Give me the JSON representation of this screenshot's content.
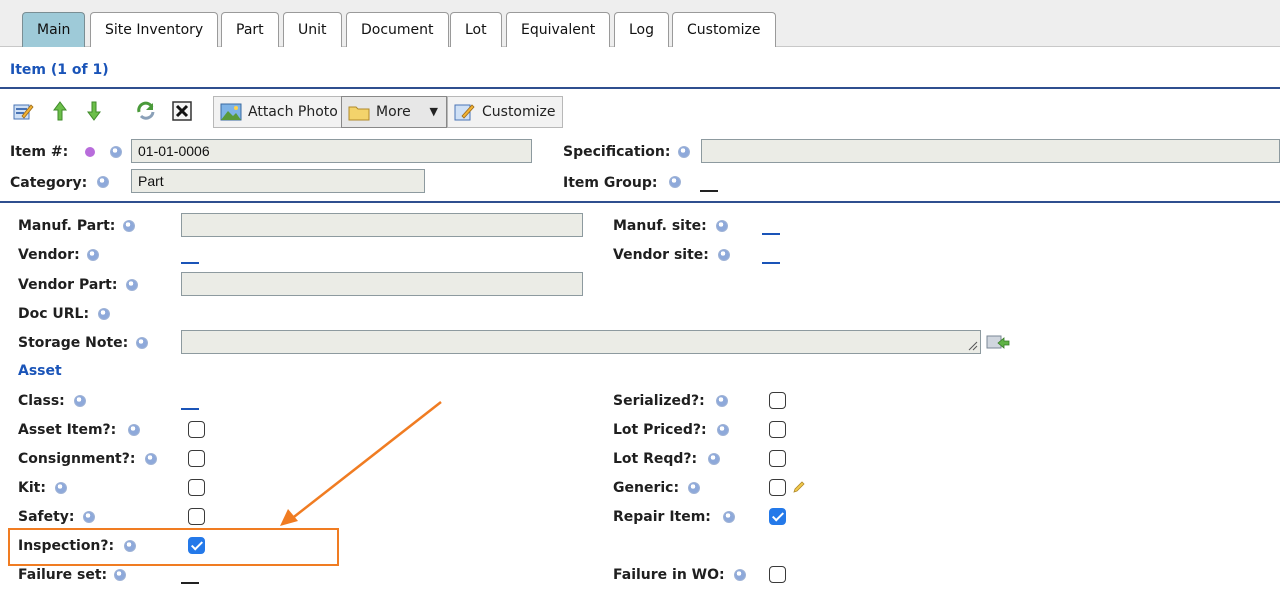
{
  "tabs": [
    "Main",
    "Site Inventory",
    "Part",
    "Unit",
    "Document",
    "Lot",
    "Equivalent",
    "Log",
    "Customize"
  ],
  "active_tab": "Main",
  "item_header": "Item (1 of 1)",
  "toolbar": {
    "attach_photo": "Attach Photo",
    "more": "More",
    "customize": "Customize"
  },
  "header_fields": {
    "item_no_label": "Item #:",
    "item_no_value": "01-01-0006",
    "category_label": "Category:",
    "category_value": "Part",
    "specification_label": "Specification:",
    "specification_value": "",
    "item_group_label": "Item Group:"
  },
  "detail": {
    "manuf_part_label": "Manuf. Part:",
    "vendor_label": "Vendor:",
    "vendor_part_label": "Vendor Part:",
    "doc_url_label": "Doc URL:",
    "storage_note_label": "Storage Note:",
    "manuf_site_label": "Manuf. site:",
    "vendor_site_label": "Vendor site:",
    "asset_section": "Asset",
    "class_label": "Class:",
    "asset_item_label": "Asset Item?:",
    "consignment_label": "Consignment?:",
    "kit_label": "Kit:",
    "safety_label": "Safety:",
    "inspection_label": "Inspection?:",
    "failure_set_label": "Failure set:",
    "serialized_label": "Serialized?:",
    "lot_priced_label": "Lot Priced?:",
    "lot_reqd_label": "Lot Reqd?:",
    "generic_label": "Generic:",
    "repair_item_label": "Repair Item:",
    "failure_in_wo_label": "Failure in WO:"
  },
  "checkbox_state": {
    "asset_item": false,
    "consignment": false,
    "kit": false,
    "safety": false,
    "inspection": true,
    "serialized": false,
    "lot_priced": false,
    "lot_reqd": false,
    "generic": false,
    "repair_item": true,
    "failure_in_wo": false
  },
  "colors": {
    "accent_blue": "#1a54b8",
    "active_tab": "#9ecad8",
    "highlight_orange": "#f07c22",
    "checkbox_checked": "#2479e9"
  }
}
